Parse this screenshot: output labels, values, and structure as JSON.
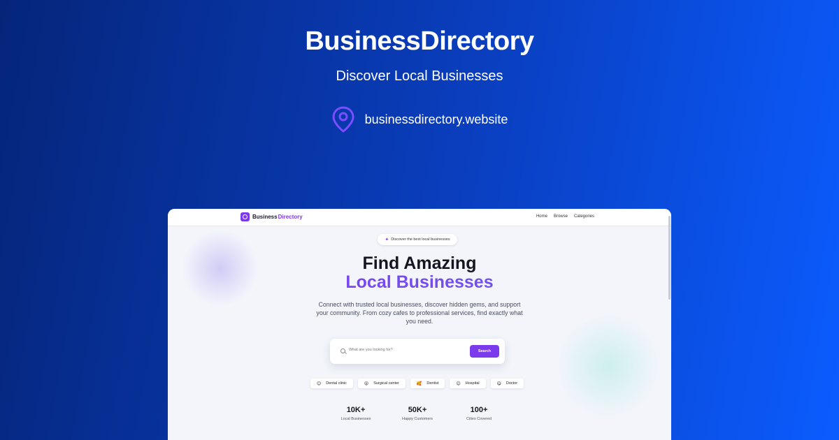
{
  "header": {
    "title": "BusinessDirectory",
    "subtitle": "Discover Local Businesses",
    "url": "businessdirectory.website",
    "url_icon": "map-pin-icon"
  },
  "site": {
    "logo_word1": "Business",
    "logo_word2": "Directory",
    "accent_color": "#7c3aed",
    "nav": [
      "Home",
      "Browse",
      "Categories"
    ],
    "badge": "Discover the best local businesses",
    "headline_line1": "Find Amazing",
    "headline_line2": "Local Businesses",
    "description": "Connect with trusted local businesses, discover hidden gems, and support your community. From cozy cafes to professional services, find exactly what you need.",
    "search": {
      "placeholder": "What are you looking for?",
      "button": "Search"
    },
    "chips": [
      {
        "emoji": "😊",
        "label": "Dental clinic"
      },
      {
        "emoji": "😝",
        "label": "Surgical center"
      },
      {
        "emoji": "🥰",
        "label": "Dentist"
      },
      {
        "emoji": "😊",
        "label": "Hospital"
      },
      {
        "emoji": "😋",
        "label": "Doctor"
      }
    ],
    "stats": [
      {
        "value": "10K+",
        "label": "Local Businesses"
      },
      {
        "value": "50K+",
        "label": "Happy Customers"
      },
      {
        "value": "100+",
        "label": "Cities Covered"
      }
    ]
  }
}
